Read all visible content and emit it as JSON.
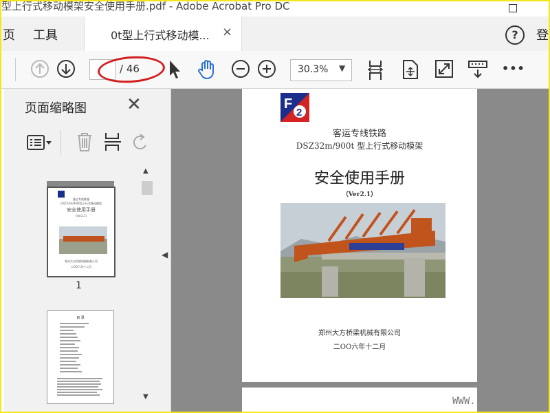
{
  "window": {
    "title": "型上行式移动模架安全使用手册.pdf - Adobe Acrobat Pro DC"
  },
  "menu": {
    "home_cut": "页",
    "tools": "工具",
    "tab_label": "0t型上行式移动模...",
    "tab_close": "×",
    "help": "?",
    "login_cut": "登"
  },
  "toolbar": {
    "page_current": "",
    "page_total": "/ 46",
    "zoom": "30.3%",
    "zoom_caret": "▼",
    "more": "•••"
  },
  "sidebar": {
    "title": "页面缩略图",
    "close": "✕",
    "thumb1_label": "1",
    "thumb1_lines": [
      "客运专线铁路",
      "DSZ32m/900t型上行式移动模架",
      "安全使用手册",
      "(Ver2.1)"
    ],
    "thumb1_company": "郑州大方桥梁机械有限公司",
    "thumb1_date": "二OO六年十二月",
    "thumb2_heading": "目 录"
  },
  "document": {
    "line1": "客运专线铁路",
    "line2": "DSZ32m/900t 型上行式移动模架",
    "title": "安全使用手册",
    "version": "（Ver2.1）",
    "company": "郑州大方桥梁机械有限公司",
    "date": "二OO六年十二月",
    "page2_url": "WWW."
  },
  "colors": {
    "accent": "#2a6fd3",
    "highlight": "#d21e1e",
    "frame": "#f5e61c"
  }
}
